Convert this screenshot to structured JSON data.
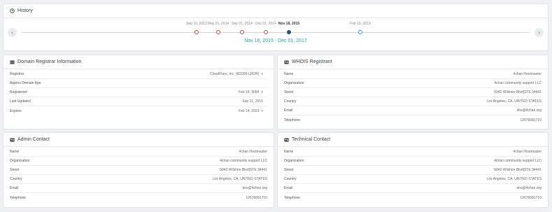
{
  "history": {
    "title": "History",
    "icon": "clock-icon",
    "timeline": [
      {
        "date": "Sep 10, 2012",
        "state": "past"
      },
      {
        "date": "May 01, 2014",
        "state": "past"
      },
      {
        "date": "Sep 01, 2014",
        "state": "past"
      },
      {
        "date": "Dec 01, 2014",
        "state": "past"
      },
      {
        "date": "Nov 18, 2015",
        "state": "current"
      },
      {
        "date": "Feb 15, 2019",
        "state": "future"
      }
    ],
    "selected_range": "Nov 18, 2015 - Dec 01, 2017",
    "prev_label": "‹",
    "next_label": "›"
  },
  "registrar": {
    "title": "Domain Registrar Information",
    "rows": [
      {
        "label": "Registrar",
        "value": "CloudFlare, Inc. (R2009-LROR)",
        "caret": "▾"
      },
      {
        "label": "Approx Domain Age",
        "value": "",
        "caret": ""
      },
      {
        "label": "Registered",
        "value": "Feb 14, 2004",
        "caret": "▾"
      },
      {
        "label": "Last Updated",
        "value": "Sep 21, 2015",
        "caret": ""
      },
      {
        "label": "Expires",
        "value": "Feb 14, 2023",
        "caret": "▾"
      }
    ]
  },
  "whois": {
    "title": "WHOIS Registrant",
    "rows": [
      {
        "label": "Name",
        "value": "4chan Hostmaster"
      },
      {
        "label": "Organization",
        "value": "4chan community support LLC"
      },
      {
        "label": "Street",
        "value": "5042 Wilshire Blvd|STE 34441"
      },
      {
        "label": "Country",
        "value": "Los Angeles, CA, UNITED STATES"
      },
      {
        "label": "Email",
        "value": "dns@4chan.org"
      },
      {
        "label": "Telephone",
        "value": "12676081710"
      }
    ]
  },
  "admin": {
    "title": "Admin Contact",
    "rows": [
      {
        "label": "Name",
        "value": "4chan Hostmaster"
      },
      {
        "label": "Organization",
        "value": "4chan community support LLC"
      },
      {
        "label": "Street",
        "value": "5042 Wilshire Blvd|STE 34441"
      },
      {
        "label": "Country",
        "value": "Los Angeles, CA, UNITED STATES"
      },
      {
        "label": "Email",
        "value": "dns@4chan.org"
      },
      {
        "label": "Telephone",
        "value": "12676081710"
      }
    ]
  },
  "tech": {
    "title": "Technical Contact",
    "rows": [
      {
        "label": "Name",
        "value": "4chan Hostmaster"
      },
      {
        "label": "Organization",
        "value": "4chan community support LLC"
      },
      {
        "label": "Street",
        "value": "5042 Wilshire Blvd|STE 34441"
      },
      {
        "label": "Country",
        "value": "Los Angeles, CA, UNITED STATES"
      },
      {
        "label": "Email",
        "value": "dns@4chan.org"
      },
      {
        "label": "Telephone",
        "value": "12676081710"
      }
    ]
  },
  "colors": {
    "accent": "#23a8a0",
    "past_dot": "#c94040",
    "current_dot": "#2f4f73"
  }
}
